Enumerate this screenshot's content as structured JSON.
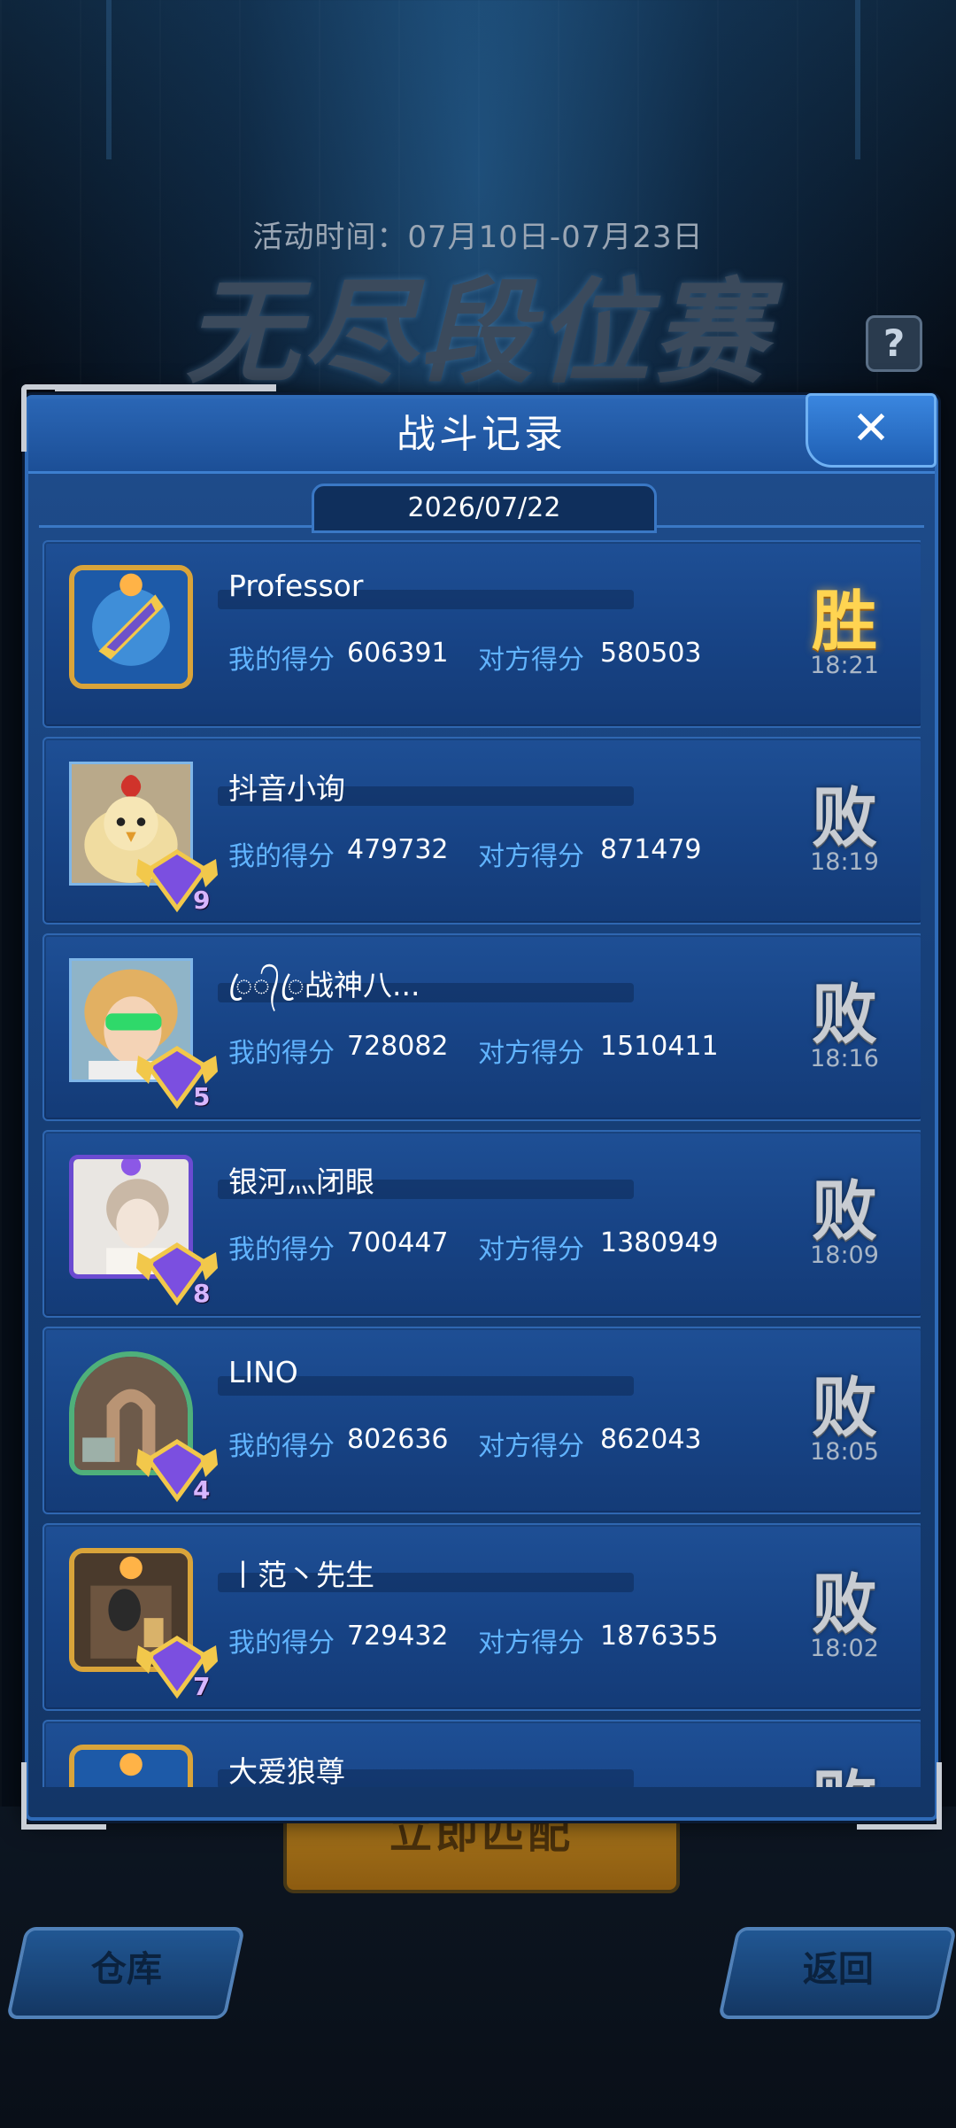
{
  "event": {
    "time_text": "活动时间：07月10日-07月23日",
    "title": "无尽段位赛",
    "help_label": "?"
  },
  "dialog": {
    "title": "战斗记录",
    "close_label": "✕",
    "date": "2026/07/22"
  },
  "labels": {
    "my_score": "我的得分",
    "opponent_score": "对方得分"
  },
  "records": [
    {
      "name": "Professor",
      "my_score": "606391",
      "opponent_score": "580503",
      "result": "胜",
      "time": "18:21",
      "rank_level": ""
    },
    {
      "name": "抖音小询",
      "my_score": "479732",
      "opponent_score": "871479",
      "result": "败",
      "time": "18:19",
      "rank_level": "9"
    },
    {
      "name": "ꦿ᭄ꦿ战神八...",
      "my_score": "728082",
      "opponent_score": "1510411",
      "result": "败",
      "time": "18:16",
      "rank_level": "5"
    },
    {
      "name": "银河灬闭眼",
      "my_score": "700447",
      "opponent_score": "1380949",
      "result": "败",
      "time": "18:09",
      "rank_level": "8"
    },
    {
      "name": "LINO",
      "my_score": "802636",
      "opponent_score": "862043",
      "result": "败",
      "time": "18:05",
      "rank_level": "4"
    },
    {
      "name": "丨范丶先生",
      "my_score": "729432",
      "opponent_score": "1876355",
      "result": "败",
      "time": "18:02",
      "rank_level": "7"
    },
    {
      "name": "大爱狼尊",
      "my_score": "",
      "opponent_score": "",
      "result": "败",
      "time": "",
      "rank_level": ""
    }
  ],
  "bottom": {
    "match_button": "立即匹配",
    "warehouse_button": "仓库",
    "back_button": "返回"
  },
  "colors": {
    "win": "#ffd451",
    "loss": "#c8ccd2",
    "score_label": "#61b4ff",
    "panel": "#17407a"
  }
}
